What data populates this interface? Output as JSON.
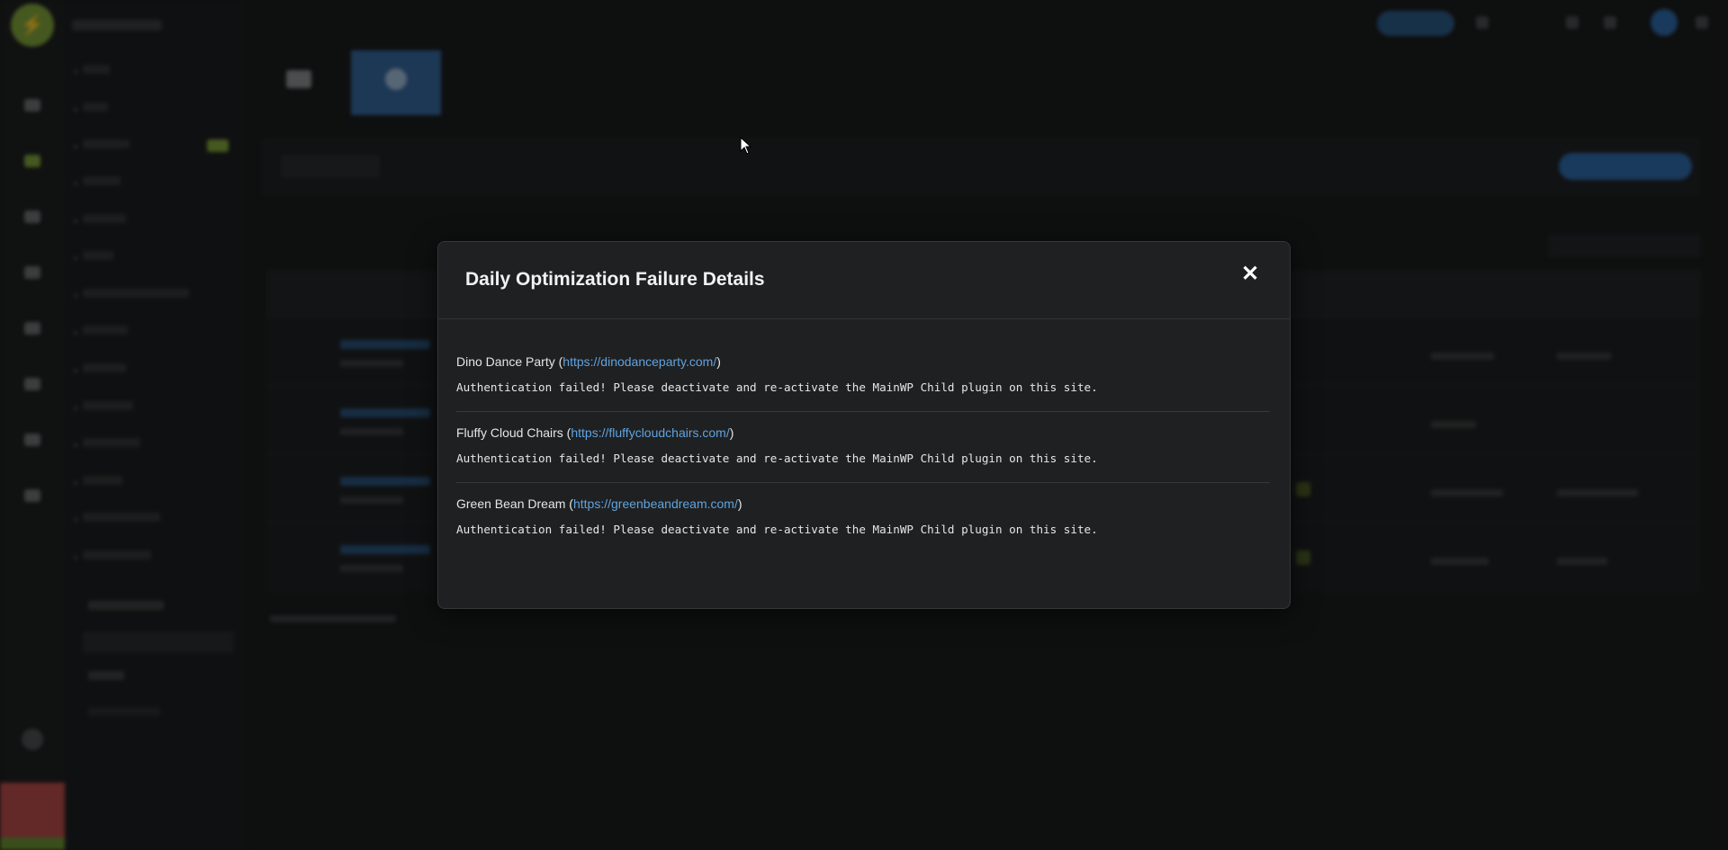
{
  "modal": {
    "title": "Daily Optimization Failure Details",
    "close_icon": "close-icon",
    "items": [
      {
        "site_name": "Dino Dance Party",
        "url": "https://dinodanceparty.com/",
        "message": "Authentication failed! Please deactivate and re-activate the MainWP Child plugin on this site."
      },
      {
        "site_name": "Fluffy Cloud Chairs",
        "url": "https://fluffycloudchairs.com/",
        "message": "Authentication failed! Please deactivate and re-activate the MainWP Child plugin on this site."
      },
      {
        "site_name": "Green Bean Dream",
        "url": "https://greenbeandream.com/",
        "message": "Authentication failed! Please deactivate and re-activate the MainWP Child plugin on this site."
      }
    ]
  },
  "colors": {
    "link": "#5fa3e0",
    "accent_green": "#7fa13b",
    "accent_blue": "#35679a"
  }
}
